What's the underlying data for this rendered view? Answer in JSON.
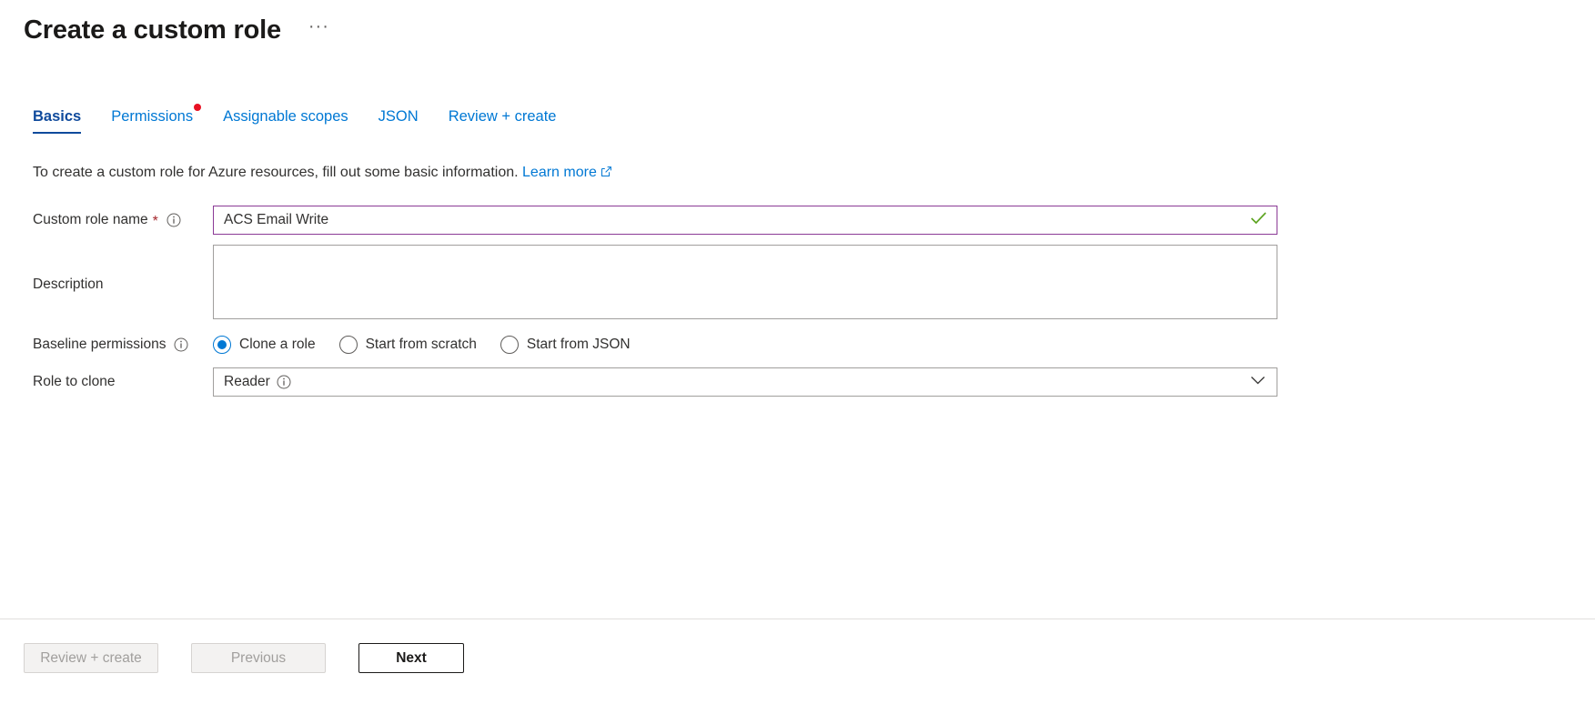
{
  "header": {
    "title": "Create a custom role",
    "more_label": "···"
  },
  "tabs": [
    {
      "label": "Basics",
      "active": true,
      "dot": false
    },
    {
      "label": "Permissions",
      "active": false,
      "dot": true
    },
    {
      "label": "Assignable scopes",
      "active": false,
      "dot": false
    },
    {
      "label": "JSON",
      "active": false,
      "dot": false
    },
    {
      "label": "Review + create",
      "active": false,
      "dot": false
    }
  ],
  "main": {
    "intro_text": "To create a custom role for Azure resources, fill out some basic information.",
    "intro_link": "Learn more",
    "fields": {
      "role_name": {
        "label": "Custom role name",
        "required_mark": "*",
        "value": "ACS Email Write",
        "placeholder": "",
        "valid": true
      },
      "description": {
        "label": "Description",
        "value": "",
        "placeholder": ""
      },
      "baseline_permissions": {
        "label": "Baseline permissions",
        "options": [
          {
            "label": "Clone a role",
            "selected": true
          },
          {
            "label": "Start from scratch",
            "selected": false
          },
          {
            "label": "Start from JSON",
            "selected": false
          }
        ]
      },
      "role_to_clone": {
        "label": "Role to clone",
        "value": "Reader"
      }
    }
  },
  "footer": {
    "buttons": [
      {
        "label": "Review + create",
        "state": "disabled"
      },
      {
        "label": "Previous",
        "state": "disabled"
      },
      {
        "label": "Next",
        "state": "default"
      }
    ]
  },
  "colors": {
    "accent": "#0078d4",
    "active_tab": "#0f4a9c",
    "required_star": "#a4262c",
    "notification_dot": "#e81123",
    "valid_border": "#8b3a96",
    "valid_check": "#5fa523"
  }
}
